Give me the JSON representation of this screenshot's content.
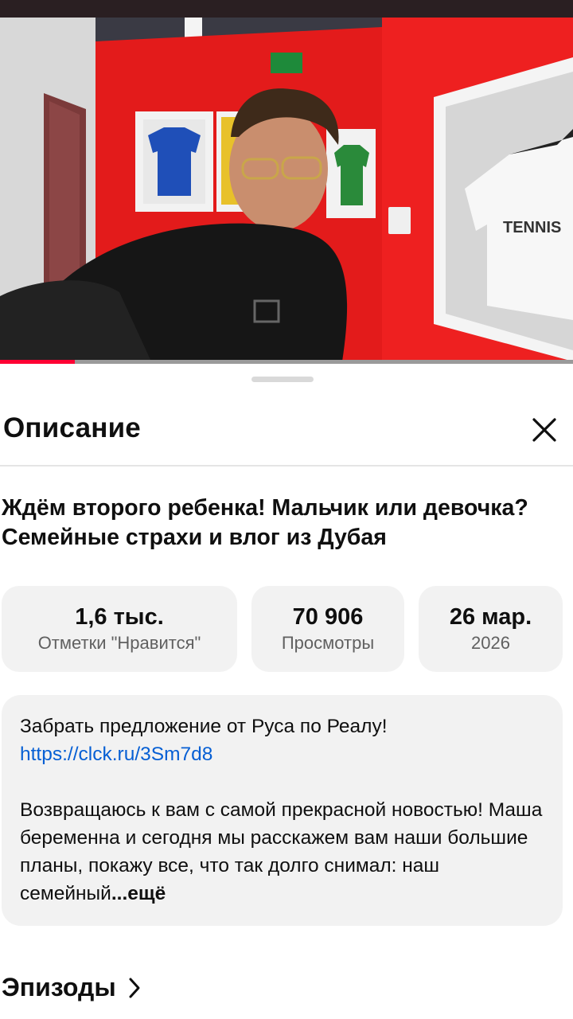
{
  "video": {
    "jersey_text": "TENNIS",
    "progress": 0.13
  },
  "panel": {
    "title": "Описание",
    "close_icon": "close-icon"
  },
  "video_title": "Ждём второго ребенка! Мальчик или девочка? Семейные страхи и влог из Дубая",
  "stats": [
    {
      "value": "1,6 тыс.",
      "label": "Отметки \"Нравится\""
    },
    {
      "value": "70 906",
      "label": "Просмотры"
    },
    {
      "value": "26 мар.",
      "label": "2026"
    }
  ],
  "description": {
    "promo_text": "Забрать предложение от Руса по Реалу! ",
    "link": "https://clck.ru/3Sm7d8",
    "body": "Возвращаюсь к вам с самой прекрасной новостью! Маша беременна и сегодня мы расскажем вам наши большие планы, покажу все, что так долго снимал: наш семейный",
    "more": "...ещё"
  },
  "episodes": {
    "label": "Эпизоды",
    "icon": "chevron-right-icon"
  },
  "colors": {
    "link": "#065fd4",
    "wall_red": "#e01a1a",
    "card_bg": "#f2f2f2",
    "progress_played": "#ff0033"
  }
}
